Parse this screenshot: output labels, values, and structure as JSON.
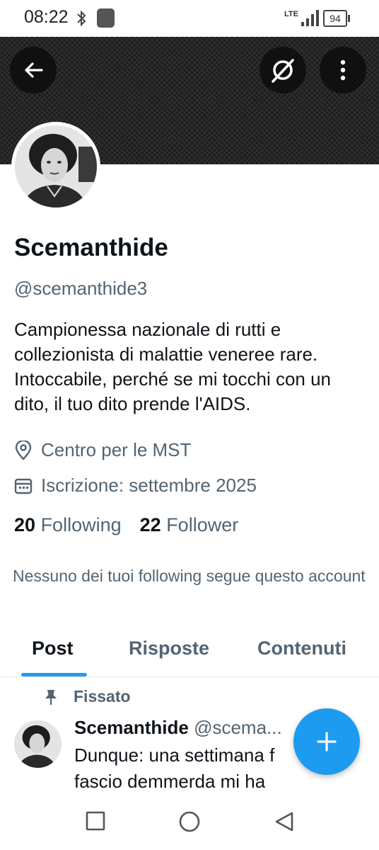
{
  "status_bar": {
    "time": "08:22",
    "network": "LTE",
    "battery": "94"
  },
  "header": {
    "back_icon": "arrow-left-icon",
    "grok_icon": "grok-icon",
    "more_icon": "more-vertical-icon"
  },
  "profile": {
    "name": "Scemanthide",
    "handle": "@scemanthide3",
    "bio": "Campionessa nazionale di rutti e collezionista di malattie veneree rare. Intoccabile, perché se mi tocchi con un dito, il tuo dito prende l'AIDS.",
    "location": "Centro per le MST",
    "joined": "Iscrizione: settembre 2025",
    "following_count": "20",
    "following_label": "Following",
    "followers_count": "22",
    "followers_label": "Follower",
    "mutuals_text": "Nessuno dei tuoi following segue questo account"
  },
  "tabs": [
    {
      "label": "Post",
      "active": true
    },
    {
      "label": "Risposte",
      "active": false
    },
    {
      "label": "Contenuti",
      "active": false
    }
  ],
  "pinned_tweet": {
    "pinned_label": "Fissato",
    "author_name": "Scemanthide",
    "author_handle": "@scema...",
    "text": "Dunque: una settimana f\nfascio demmerda mi ha"
  },
  "colors": {
    "accent": "#1d9bf0",
    "text_primary": "#0f1419",
    "text_secondary": "#536471"
  }
}
